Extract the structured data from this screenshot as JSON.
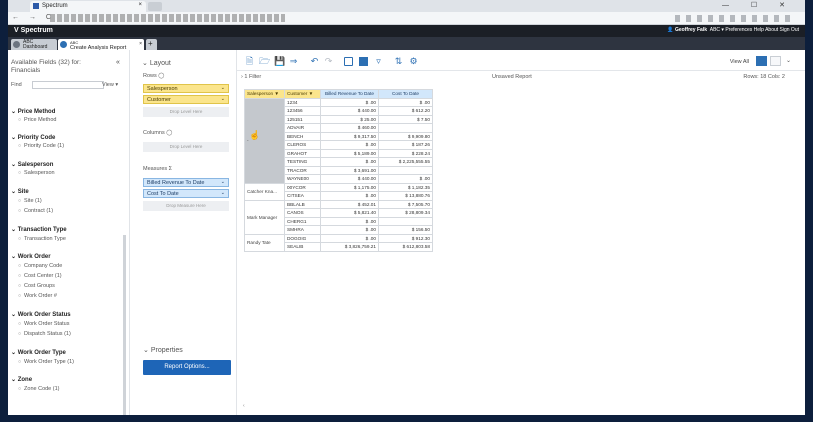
{
  "browser": {
    "tab_title": "Spectrum",
    "tab_close": "×",
    "nav": "← → C",
    "window_controls": "— ☐ ✕"
  },
  "app": {
    "brand": "Spectrum",
    "user": "Geoffrey Falk",
    "user_menu": "ABC ▾   Preferences   Help   About   Sign Out",
    "tabs": [
      {
        "label": "Dashboard",
        "sub": "ABC"
      },
      {
        "label": "Create Analysis Report",
        "sub": "ABC"
      },
      {
        "label": "+"
      }
    ],
    "tab_close": "×"
  },
  "fields_panel": {
    "title": "Available Fields (32) for: Financials",
    "collapse": "«",
    "find_label": "Find",
    "view_label": "View ▾",
    "groups": [
      {
        "name": "Price Method",
        "items": [
          "Price Method"
        ]
      },
      {
        "name": "Priority Code",
        "items": [
          "Priority Code (1)"
        ]
      },
      {
        "name": "Salesperson",
        "items": [
          "Salesperson"
        ]
      },
      {
        "name": "Site",
        "items": [
          "Site (1)",
          "Contract (1)"
        ]
      },
      {
        "name": "Transaction Type",
        "items": [
          "Transaction Type"
        ]
      },
      {
        "name": "Work Order",
        "items": [
          "Company Code",
          "Cost Center (1)",
          "Cost Groups",
          "Work Order #"
        ]
      },
      {
        "name": "Work Order Status",
        "items": [
          "Work Order Status",
          "Dispatch Status (1)"
        ]
      },
      {
        "name": "Work Order Type",
        "items": [
          "Work Order Type (1)"
        ]
      },
      {
        "name": "Zone",
        "items": [
          "Zone Code (1)"
        ]
      }
    ]
  },
  "layout_panel": {
    "title": "Layout",
    "rows_label": "Rows",
    "rows": [
      "Salesperson",
      "Customer"
    ],
    "rows_drop": "Drop Level Here",
    "columns_label": "Columns",
    "columns_drop": "Drop Level Here",
    "measures_label": "Measures",
    "measures": [
      "Billed Revenue To Date",
      "Cost To Date"
    ],
    "measures_drop": "Drop Measure Here",
    "properties_label": "Properties",
    "report_options_button": "Report Options..."
  },
  "report": {
    "filter_count": "1 Filter",
    "title": "Unsaved Report",
    "row_col_count": "Rows: 18  Cols: 2",
    "view_all": "View All",
    "columns": [
      "Salesperson ▼",
      "Customer ▼",
      "Billed Revenue To Date",
      "Cost To Date"
    ],
    "groups": [
      {
        "salesperson": "-",
        "rows": [
          [
            "1234",
            "$ .00",
            "$ .00"
          ],
          [
            "123456",
            "$ 440.00",
            "$ 612.20"
          ],
          [
            "125151",
            "$ 25.00",
            "$ 7.50"
          ],
          [
            "ADVAIR",
            "$ 460.00",
            ""
          ],
          [
            "BENCH",
            "$ 9,317.50",
            "$ 9,909.80"
          ],
          [
            "CLEROS",
            "$ .00",
            "$ 187.26"
          ],
          [
            "GRAHOT",
            "$ 5,189.00",
            "$ 228.24"
          ],
          [
            "TESTING",
            "$ .00",
            "$ 2,225,555.55"
          ],
          [
            "TRACOR",
            "$ 3,691.00",
            ""
          ],
          [
            "WAYNE00",
            "$ 440.00",
            "$ .00"
          ]
        ]
      },
      {
        "salesperson": "Catcher Kna...",
        "rows": [
          [
            "00YCOR",
            "$ 1,175.00",
            "$ 1,182.35"
          ],
          [
            "CITSEA",
            "$ .00",
            "$ 13,880.76"
          ]
        ]
      },
      {
        "salesperson": "Mark Manager",
        "rows": [
          [
            "BBLALB",
            "$ 452.01",
            "$ 7,505.70"
          ],
          [
            "CANOS",
            "$ 5,821.40",
            "$ 28,809.34"
          ],
          [
            "CHERG1",
            "$ .00",
            ""
          ],
          [
            "SMHRA",
            "$ .00",
            "$ 156.50"
          ]
        ]
      },
      {
        "salesperson": "Randy Tate",
        "rows": [
          [
            "DOGOIG",
            "$ .00",
            "$ 912.30"
          ],
          [
            "SEALIB",
            "$ 3,826,759.21",
            "$ 612,803.58"
          ]
        ]
      }
    ]
  }
}
